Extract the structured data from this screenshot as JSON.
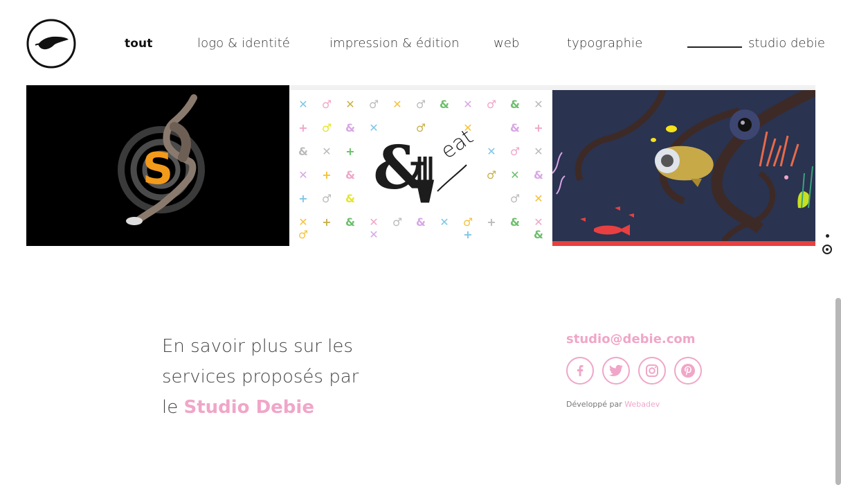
{
  "header": {
    "logo_alt": "Studio Debie logo",
    "nav": [
      {
        "label": "tout",
        "active": true
      },
      {
        "label": "logo & identité",
        "active": false
      },
      {
        "label": "impression & édition",
        "active": false
      },
      {
        "label": "web",
        "active": false
      },
      {
        "label": "typographie",
        "active": false
      }
    ],
    "studio_link": "studio debie"
  },
  "gallery": {
    "tiles": [
      {
        "name": "sprinter-s-logo"
      },
      {
        "name": "eat-eet-pattern",
        "text": "eat"
      },
      {
        "name": "underwater-illustration"
      }
    ]
  },
  "footer": {
    "about_line1": "En savoir plus sur les",
    "about_line2": "services proposés par",
    "about_prefix": "le ",
    "about_brand": "Studio Debie",
    "email": "studio@debie.com",
    "socials": [
      "facebook-icon",
      "twitter-icon",
      "instagram-icon",
      "pinterest-icon"
    ],
    "credit_prefix": "Développé par ",
    "credit_dev": "Webadev"
  },
  "colors": {
    "accent": "#f0a6c8",
    "text": "#333333",
    "tile_dark": "#000000",
    "sea": "#2a3350"
  }
}
